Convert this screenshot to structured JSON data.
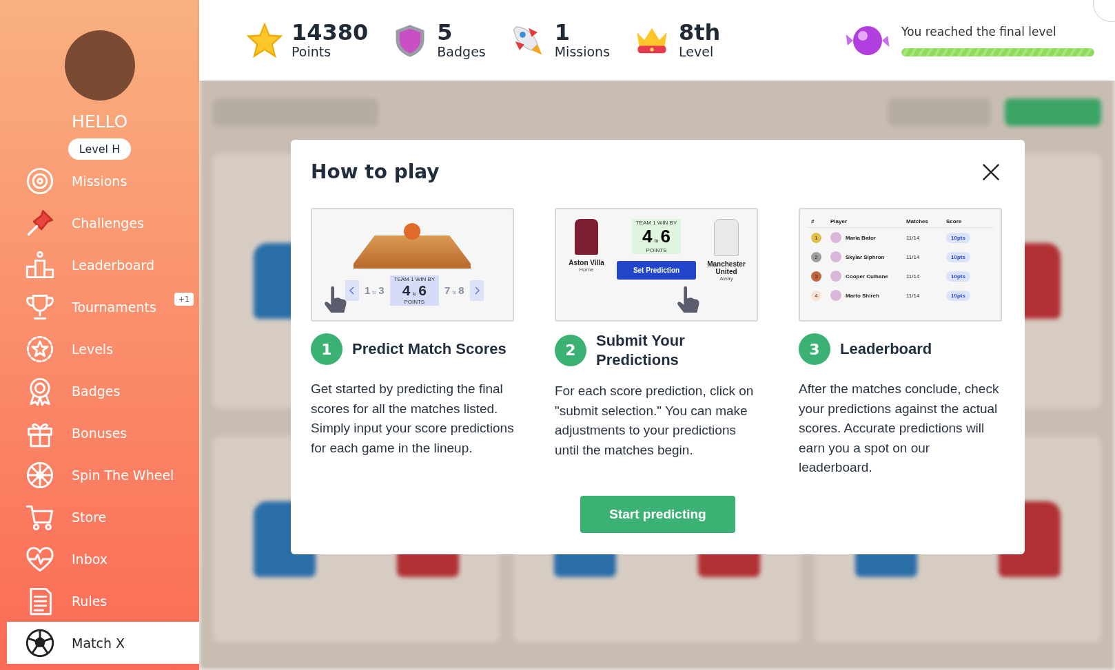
{
  "sidebar": {
    "greeting": "HELLO",
    "level_badge": "Level H",
    "items": [
      {
        "label": "Missions",
        "selected": false
      },
      {
        "label": "Challenges",
        "selected": false
      },
      {
        "label": "Leaderboard",
        "selected": false
      },
      {
        "label": "Tournaments",
        "selected": false,
        "badge": "+1"
      },
      {
        "label": "Levels",
        "selected": false
      },
      {
        "label": "Badges",
        "selected": false
      },
      {
        "label": "Bonuses",
        "selected": false
      },
      {
        "label": "Spin The Wheel",
        "selected": false
      },
      {
        "label": "Store",
        "selected": false
      },
      {
        "label": "Inbox",
        "selected": false
      },
      {
        "label": "Rules",
        "selected": false
      },
      {
        "label": "Match X",
        "selected": true
      }
    ]
  },
  "stats": [
    {
      "kind": "star",
      "value": "14380",
      "label": "Points"
    },
    {
      "kind": "shield",
      "value": "5",
      "label": "Badges"
    },
    {
      "kind": "rocket",
      "value": "1",
      "label": "Missions"
    },
    {
      "kind": "crown",
      "value": "8th",
      "label": "Level"
    }
  ],
  "progress": {
    "text": "You reached the final level",
    "level": 1
  },
  "modal": {
    "title": "How to play",
    "button": "Start predicting",
    "steps": [
      {
        "number": "1",
        "title": "Predict Match Scores",
        "text": "Get started by predicting the final scores for all the matches listed. Simply input your score predictions for each game in the lineup.",
        "illustration": {
          "kind": "score-picker",
          "caption": "TEAM 1 WIN BY",
          "unit": "POINTS",
          "options": [
            {
              "from": "1",
              "joiner": "to",
              "to": "3",
              "selected": false
            },
            {
              "from": "4",
              "joiner": "to",
              "to": "6",
              "selected": true
            },
            {
              "from": "7",
              "joiner": "to",
              "to": "8",
              "selected": false
            }
          ]
        }
      },
      {
        "number": "2",
        "title": "Submit Your Predictions",
        "text": "For each score prediction, click on \"submit selection.\" You can make adjustments to your predictions until the matches begin.",
        "illustration": {
          "kind": "set-prediction",
          "caption": "TEAM 1 WIN BY",
          "score_from": "4",
          "joiner": "to",
          "score_to": "6",
          "unit": "POINTS",
          "button": "Set Prediction",
          "home": {
            "name": "Aston Villa",
            "side": "Home"
          },
          "away": {
            "name": "Manchester United",
            "side": "Away"
          }
        }
      },
      {
        "number": "3",
        "title": "Leaderboard",
        "text": "After the matches conclude, check your predictions against the actual scores. Accurate predictions will earn you a spot on our leaderboard.",
        "illustration": {
          "kind": "leaderboard",
          "columns": [
            "#",
            "Player",
            "Matches",
            "Score"
          ],
          "rows": [
            {
              "rank": "1",
              "color": "#e2c14a",
              "player": "Maria Bator",
              "matches": "11/14",
              "score": "10pts"
            },
            {
              "rank": "2",
              "color": "#9e9e9e",
              "player": "Skylar Siphron",
              "matches": "11/14",
              "score": "10pts"
            },
            {
              "rank": "3",
              "color": "#c0673f",
              "player": "Cooper Culhane",
              "matches": "11/14",
              "score": "10pts"
            },
            {
              "rank": "4",
              "color": "#fbe3cf",
              "player": "Marto Shireh",
              "matches": "11/14",
              "score": "10pts"
            }
          ]
        }
      }
    ]
  }
}
